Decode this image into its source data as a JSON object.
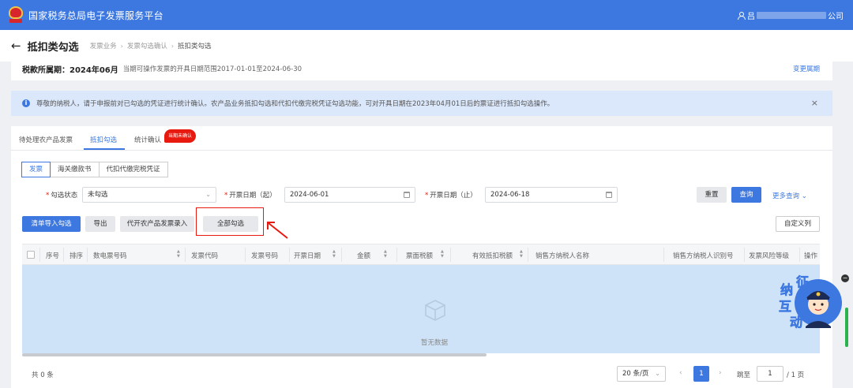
{
  "app": {
    "title": "国家税务总局电子发票服务平台"
  },
  "user": {
    "name_prefix": "吕",
    "name_suffix": "公司"
  },
  "page": {
    "title": "抵扣类勾选",
    "breadcrumbs": [
      "发票业务",
      "发票勾选确认",
      "抵扣类勾选"
    ]
  },
  "period": {
    "label": "税款所属期：",
    "value": "2024年06月",
    "range_text": "当期可操作发票的开具日期范围2017-01-01至2024-06-30",
    "change_link": "变更属期"
  },
  "notice": {
    "text": "尊敬的纳税人，请于申报前对已勾选的凭证进行统计确认。农产品业务抵扣勾选和代扣代缴完税凭证勾选功能，可对开具日期在2023年04月01日后的票证进行抵扣勾选操作。",
    "close": "×"
  },
  "tabs": [
    {
      "label": "待处理农产品发票"
    },
    {
      "label": "抵扣勾选"
    },
    {
      "label": "统计确认"
    }
  ],
  "tab_badge": "当期未确认",
  "subtabs": [
    {
      "label": "发票"
    },
    {
      "label": "海关缴款书"
    },
    {
      "label": "代扣代缴完税凭证"
    }
  ],
  "filters": {
    "status_label": "勾选状态",
    "status_value": "未勾选",
    "date_from_label": "开票日期（起）",
    "date_from_value": "2024-06-01",
    "date_to_label": "开票日期（止）",
    "date_to_value": "2024-06-18",
    "reset": "重置",
    "search": "查询",
    "more": "更多查询"
  },
  "actions": {
    "import_check": "清单导入勾选",
    "export": "导出",
    "agri_entry": "代开农产品发票录入",
    "check_all": "全部勾选",
    "custom_columns": "自定义列"
  },
  "table": {
    "columns": [
      "序号",
      "排序",
      "数电票号码",
      "发票代码",
      "发票号码",
      "开票日期",
      "金额",
      "票面税额",
      "有效抵扣税额",
      "销售方纳税人名称",
      "销售方纳税人识别号",
      "发票风险等级",
      "操作"
    ],
    "empty_text": "暂无数据"
  },
  "pagination": {
    "total": "共 0 条",
    "page_size": "20 条/页",
    "current_page": "1",
    "jump_label": "跳至",
    "jump_value": "1",
    "total_pages": "/ 1 页"
  },
  "mascot": {
    "chars": [
      "征",
      "纳",
      "互",
      "动"
    ]
  },
  "colors": {
    "primary": "#3d78e0",
    "highlight": "#e8190f",
    "badge": "#e8190f",
    "notice_bg": "#dbe8fb"
  }
}
